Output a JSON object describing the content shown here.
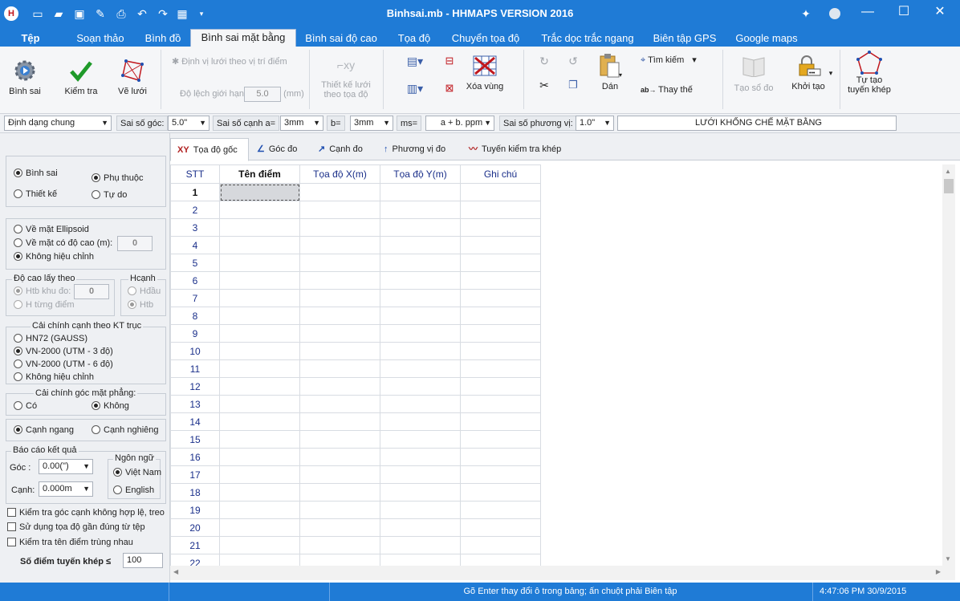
{
  "window": {
    "title": "Binhsai.mb - HHMAPS VERSION 2016",
    "controls": [
      "—",
      "☐",
      "✕"
    ]
  },
  "ribbon_tabs": [
    {
      "label": "Tệp"
    },
    {
      "label": "Soạn thảo"
    },
    {
      "label": "Bình đồ"
    },
    {
      "label": "Bình sai mặt bằng"
    },
    {
      "label": "Bình sai độ cao"
    },
    {
      "label": "Tọa độ"
    },
    {
      "label": "Chuyển tọa độ"
    },
    {
      "label": "Trắc dọc trắc ngang"
    },
    {
      "label": "Biên tập GPS"
    },
    {
      "label": "Google maps"
    }
  ],
  "ribbon": {
    "binh_sai": "Bình sai",
    "kiem_tra": "Kiểm tra",
    "ve_luoi": "Vẽ lưới",
    "dinh_vi": "Định vị lưới theo vị trí điểm",
    "do_lech_label": "Độ lệch giới hạn",
    "do_lech_value": "5.0",
    "do_lech_unit": "(mm)",
    "thiet_ke_1": "Thiết kế lưới",
    "thiet_ke_2": "theo tọa độ",
    "xoa_vung": "Xóa vùng",
    "dan": "Dán",
    "tim_kiem": "Tìm kiếm",
    "thay_the": "Thay thế",
    "tao_so_do": "Tạo sổ đo",
    "khoi_tao": "Khởi tạo",
    "tu_tao_1": "Tự tạo",
    "tu_tao_2": "tuyến khép"
  },
  "format_bar": {
    "dinh_dang": "Định dạng chung",
    "sai_so_goc_label": "Sai số góc:",
    "sai_so_goc": "5.0\"",
    "sai_so_canh_label": "Sai số cạnh a=",
    "a_value": "3mm",
    "b_label": "b=",
    "b_value": "3mm",
    "ms_label": "ms=",
    "ms_value": "a + b. ppm",
    "phuong_vi_label": "Sai số phương vị:",
    "phuong_vi": "1.0\"",
    "luoi_title": "LƯỚI KHỐNG CHẾ MẶT BẰNG"
  },
  "left": {
    "binh_sai": "Bình sai",
    "thiet_ke": "Thiết kế",
    "phu_thuoc": "Phụ thuộc",
    "tu_do": "Tự do",
    "ve_mat_ellipsoid": "Về mặt Ellipsoid",
    "ve_mat_co_do_cao": "Về mặt có độ cao (m):",
    "do_cao_value": "0",
    "khong_hieu_chinh": "Không hiệu chỉnh",
    "do_cao_lay_theo": "Độ cao lấy theo",
    "htb_khu_do": "Htb khu đo:",
    "htb_value": "0",
    "h_tung_diem": "H từng điểm",
    "hcanh": "Hcạnh",
    "hdau": "Hđầu",
    "htb": "Htb",
    "cai_chinh_canh": "Cải chính cạnh theo KT trục",
    "hn72": "HN72  (GAUSS)",
    "vn2000_3": "VN-2000 (UTM - 3 độ)",
    "vn2000_6": "VN-2000 (UTM - 6 độ)",
    "khong_hieu_chinh_2": "Không hiệu chỉnh",
    "cai_chinh_goc": "Cải chính góc mặt phẳng:",
    "co": "Có",
    "khong": "Không",
    "canh_ngang": "Cạnh ngang",
    "canh_nghieng": "Cạnh nghiêng",
    "bao_cao": "Báo cáo kết quả",
    "goc_label": "Góc   :",
    "goc_value": "0.00(\")",
    "canh_label": "Cạnh:",
    "canh_value": "0.000m",
    "ngon_ngu": "Ngôn ngữ",
    "viet_nam": "Việt Nam",
    "english": "English",
    "chk1": "Kiểm tra góc cạnh không hợp lệ, treo",
    "chk2": "Sử dụng tọa độ gần đúng từ tệp",
    "chk3": "Kiểm tra tên điểm trùng nhau",
    "so_diem_label": "Số điểm tuyến khép ≤",
    "so_diem_value": "100"
  },
  "sub_tabs": [
    {
      "label": "Tọa độ gốc",
      "icon": "XY"
    },
    {
      "label": "Góc đo",
      "icon": "∠"
    },
    {
      "label": "Cạnh đo",
      "icon": "↗"
    },
    {
      "label": "Phương vị đo",
      "icon": "↑"
    },
    {
      "label": "Tuyến kiểm tra khép",
      "icon": "〰"
    }
  ],
  "table": {
    "headers": [
      "STT",
      "Tên điểm",
      "Tọa độ X(m)",
      "Tọa độ Y(m)",
      "Ghi chú"
    ],
    "rows": [
      "1",
      "2",
      "3",
      "4",
      "5",
      "6",
      "7",
      "8",
      "9",
      "10",
      "11",
      "12",
      "13",
      "14",
      "15",
      "16",
      "17",
      "18",
      "19",
      "20",
      "21",
      "22"
    ]
  },
  "status": {
    "message": "Gõ Enter thay đổi ô trong bảng; ấn chuột phải Biên tập",
    "datetime": "4:47:06 PM 30/9/2015"
  },
  "colors": {
    "titlebar": "#1f7bd6",
    "accent_red": "#c0181e"
  }
}
